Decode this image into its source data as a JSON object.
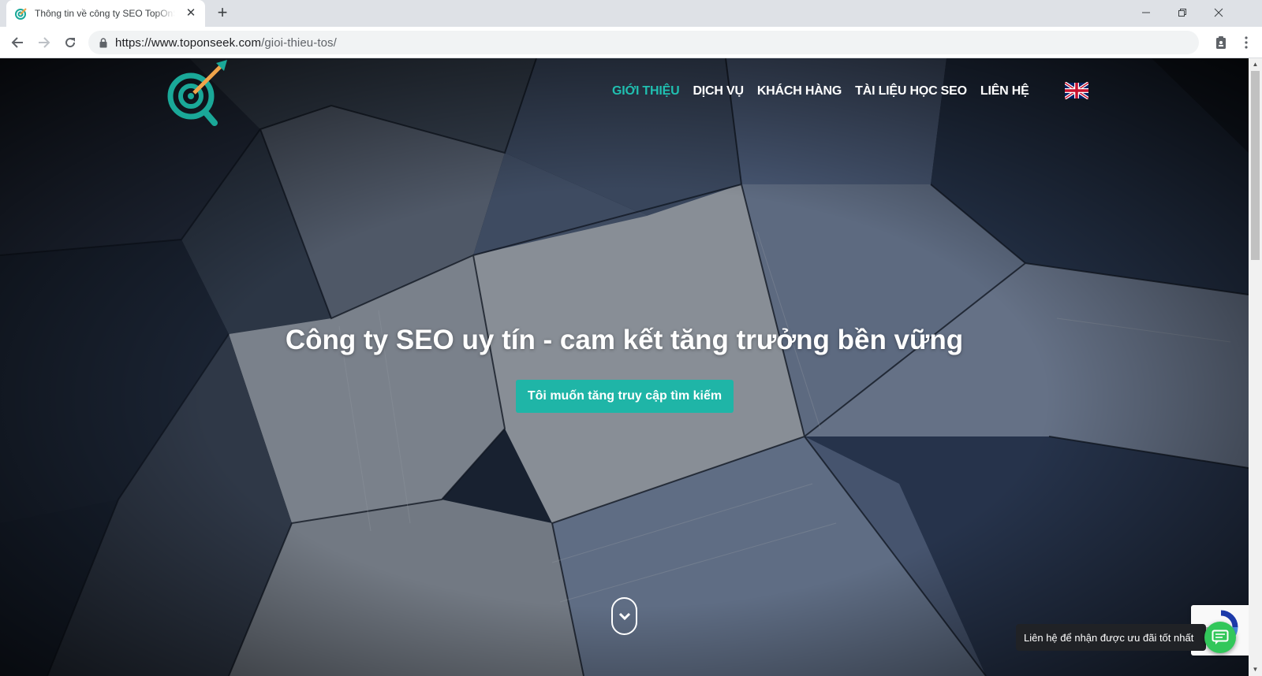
{
  "browser": {
    "tab_title": "Thông tin về công ty SEO TopOnSeek",
    "url_host": "https://www.toponseek.com",
    "url_path": "/gioi-thieu-tos/",
    "tab_close": "✕",
    "new_tab": "+"
  },
  "nav": {
    "items": [
      "Giới thiệu",
      "Dịch vụ",
      "Khách hàng",
      "Tài liệu học SEO",
      "Liên hệ"
    ],
    "active_index": 0,
    "language_flag": "uk-flag-icon"
  },
  "hero": {
    "title": "Công ty SEO uy tín - cam kết tăng trưởng bền vững",
    "cta": "Tôi muốn tăng truy cập tìm kiếm"
  },
  "chat": {
    "tooltip": "Liên hệ để nhận được ưu đãi tốt nhất"
  },
  "colors": {
    "accent": "#1fb5a7",
    "nav_active": "#20bfb0",
    "chat_button": "#32c75a",
    "logo_teal": "#1aa898",
    "logo_orange": "#f0a44a"
  }
}
